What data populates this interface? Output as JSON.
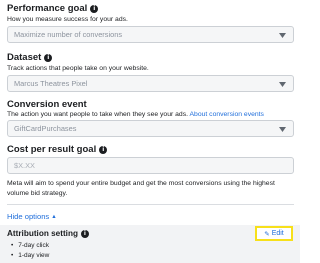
{
  "performance_goal": {
    "title": "Performance goal",
    "description": "How you measure success for your ads.",
    "selected": "Maximize number of conversions"
  },
  "dataset": {
    "title": "Dataset",
    "description": "Track actions that people take on your website.",
    "selected": "Marcus Theatres Pixel"
  },
  "conversion_event": {
    "title": "Conversion event",
    "description": "The action you want people to take when they see your ads.",
    "link": "About conversion events",
    "selected": "GiftCardPurchases"
  },
  "cost_goal": {
    "title": "Cost per result goal",
    "placeholder": "$X.XX",
    "helper_line1": "Meta will aim to spend your entire budget and get the most conversions using the highest",
    "helper_line2": "volume bid strategy."
  },
  "hide_options": {
    "label": "Hide options",
    "caret": "▲"
  },
  "attribution": {
    "title": "Attribution setting",
    "items": [
      "7-day click",
      "1-day view"
    ],
    "edit_label": "Edit"
  },
  "colors": {
    "link": "#216fdb",
    "highlight": "#f7e01a",
    "field_bg": "#f5f6f7"
  }
}
